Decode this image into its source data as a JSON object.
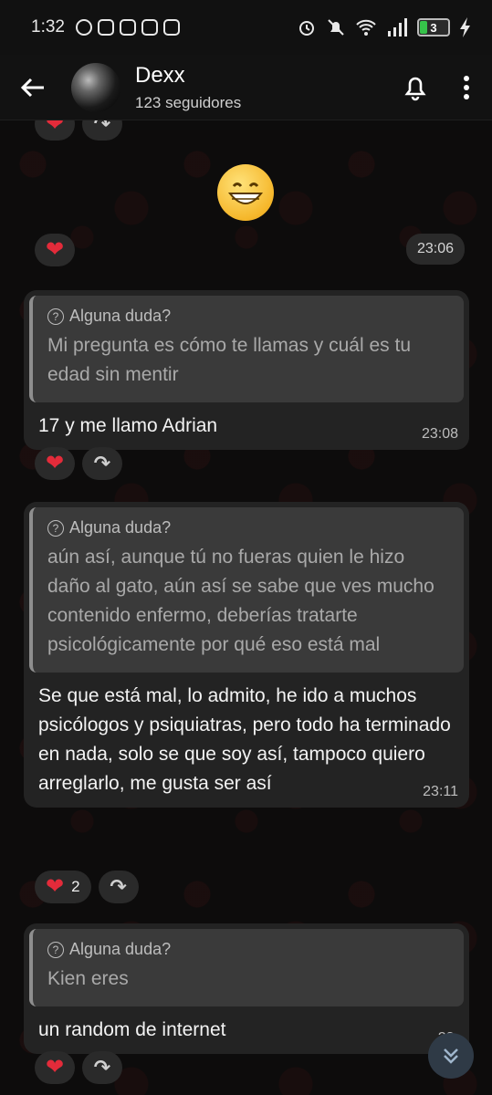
{
  "status_bar": {
    "time": "1:32",
    "battery": "3"
  },
  "header": {
    "name": "Dexx",
    "subtitle": "123 seguidores"
  },
  "emoji": "😁",
  "standalone_time": "23:06",
  "messages": [
    {
      "quote_label": "Alguna duda?",
      "quote_text": "Mi pregunta es cómo te llamas y cuál es tu edad sin mentir",
      "text": "17 y me llamo Adrian",
      "time": "23:08"
    },
    {
      "quote_label": "Alguna duda?",
      "quote_text": "aún así, aunque tú no fueras quien le hizo daño al gato, aún así se sabe que ves mucho contenido enfermo, deberías tratarte psicológicamente por qué eso está mal",
      "text": "Se que está mal, lo admito, he ido a muchos psicólogos y psiquiatras, pero todo ha terminado en nada, solo se que soy así, tampoco quiero arreglarlo, me gusta ser así",
      "time": "23:11",
      "reaction_count": "2"
    },
    {
      "quote_label": "Alguna duda?",
      "quote_text": "Kien eres",
      "text": "un random de internet",
      "time": "23:"
    }
  ],
  "colors": {
    "heart": "#e32b3a",
    "bubble": "#232323",
    "quote": "#3a3a3a"
  }
}
